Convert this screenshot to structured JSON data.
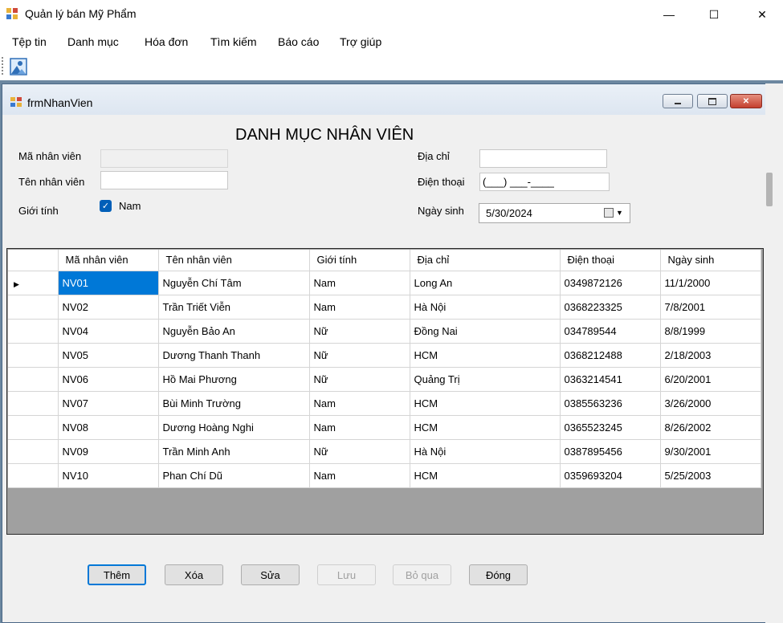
{
  "window": {
    "title": "Quản lý bán Mỹ Phẩm",
    "minimize": "—",
    "maximize": "☐",
    "close": "✕"
  },
  "menu": [
    "Tệp tin",
    "Danh mục",
    "Hóa đơn",
    "Tìm kiếm",
    "Báo cáo",
    "Trợ giúp"
  ],
  "child": {
    "title": "frmNhanVien"
  },
  "form": {
    "heading": "DANH MỤC NHÂN VIÊN",
    "ma_nv_label": "Mã nhân viên",
    "ten_nv_label": "Tên nhân viên",
    "gioi_tinh_label": "Giới tính",
    "nam_label": "Nam",
    "nam_checked": true,
    "dia_chi_label": "Địa chỉ",
    "dien_thoai_label": "Điện thoại",
    "dien_thoai_mask": "(___) ___-____",
    "ngay_sinh_label": "Ngày sinh",
    "ngay_sinh_value": "5/30/2024"
  },
  "grid": {
    "columns": [
      "Mã nhân viên",
      "Tên nhân viên",
      "Giới tính",
      "Địa chỉ",
      "Điện thoại",
      "Ngày sinh"
    ],
    "rows": [
      [
        "NV01",
        "Nguyễn Chí Tâm",
        "Nam",
        "Long An",
        "0349872126",
        "11/1/2000"
      ],
      [
        "NV02",
        "Trần Triết Viễn",
        "Nam",
        "Hà Nội",
        "0368223325",
        "7/8/2001"
      ],
      [
        "NV04",
        "Nguyễn Bảo An",
        "Nữ",
        "Đồng Nai",
        "034789544",
        "8/8/1999"
      ],
      [
        "NV05",
        "Dương Thanh Thanh",
        "Nữ",
        "HCM",
        "0368212488",
        "2/18/2003"
      ],
      [
        "NV06",
        "Hồ Mai Phương",
        "Nữ",
        "Quảng Trị",
        "0363214541",
        "6/20/2001"
      ],
      [
        "NV07",
        "Bùi Minh Trường",
        "Nam",
        "HCM",
        "0385563236",
        "3/26/2000"
      ],
      [
        "NV08",
        "Dương Hoàng Nghi",
        "Nam",
        "HCM",
        "0365523245",
        "8/26/2002"
      ],
      [
        "NV09",
        "Trần Minh Anh",
        "Nữ",
        "Hà Nội",
        "0387895456",
        "9/30/2001"
      ],
      [
        "NV10",
        "Phan Chí Dũ",
        "Nam",
        "HCM",
        "0359693204",
        "5/25/2003"
      ]
    ]
  },
  "buttons": {
    "them": "Thêm",
    "xoa": "Xóa",
    "sua": "Sửa",
    "luu": "Lưu",
    "bo_qua": "Bỏ qua",
    "dong": "Đóng"
  },
  "colors": {
    "selection": "#0078d7",
    "mdi_background": "#6c87a0",
    "grid_empty": "#a0a0a0"
  }
}
